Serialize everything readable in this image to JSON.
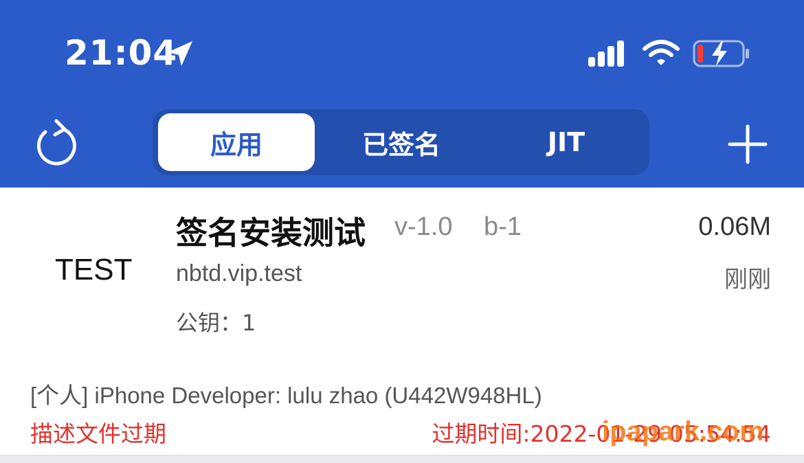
{
  "status_bar": {
    "time": "21:04",
    "icons": [
      "location-arrow-icon",
      "signal-icon",
      "wifi-icon",
      "battery-charging-icon"
    ]
  },
  "nav": {
    "refresh_icon": "refresh-icon",
    "tabs": [
      {
        "label": "应用",
        "active": true
      },
      {
        "label": "已签名",
        "active": false
      },
      {
        "label": "JIT",
        "active": false
      }
    ],
    "add_icon": "plus-icon"
  },
  "app": {
    "icon_text": "TEST",
    "name": "签名安装测试",
    "version": "v-1.0",
    "build": "b-1",
    "size": "0.06M",
    "bundle_id": "nbtd.vip.test",
    "time_ago": "刚刚",
    "public_key": "公钥：1",
    "certificate": "[个人] iPhone Developer: lulu zhao (U442W948HL)",
    "expired_label": "描述文件过期",
    "expire_time": "过期时间:2022-01-29 05:54:54"
  },
  "watermark": "ipapark.com",
  "colors": {
    "header_bg": "#2a5bc8",
    "segment_bg": "#234fae",
    "error_red": "#e2322c"
  }
}
